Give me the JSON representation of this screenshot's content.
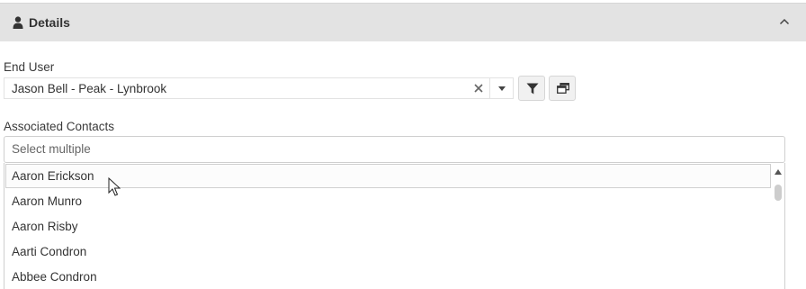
{
  "panel": {
    "title": "Details",
    "icon": "user-icon",
    "collapse_icon": "chevron-up-icon"
  },
  "end_user": {
    "label": "End User",
    "value": "Jason Bell - Peak - Lynbrook",
    "clear_icon": "close-icon",
    "dropdown_icon": "caret-down-icon",
    "filter_icon": "filter-icon",
    "lookup_icon": "windows-icon"
  },
  "associated_contacts": {
    "label": "Associated Contacts",
    "placeholder": "Select multiple",
    "options": [
      "Aaron Erickson",
      "Aaron Munro",
      "Aaron Risby",
      "Aarti Condron",
      "Abbee Condron"
    ],
    "hovered_option": "Aaron Erickson"
  },
  "colors": {
    "header_bg": "#e3e3e3",
    "border": "#cfcfcf",
    "text": "#333333"
  }
}
